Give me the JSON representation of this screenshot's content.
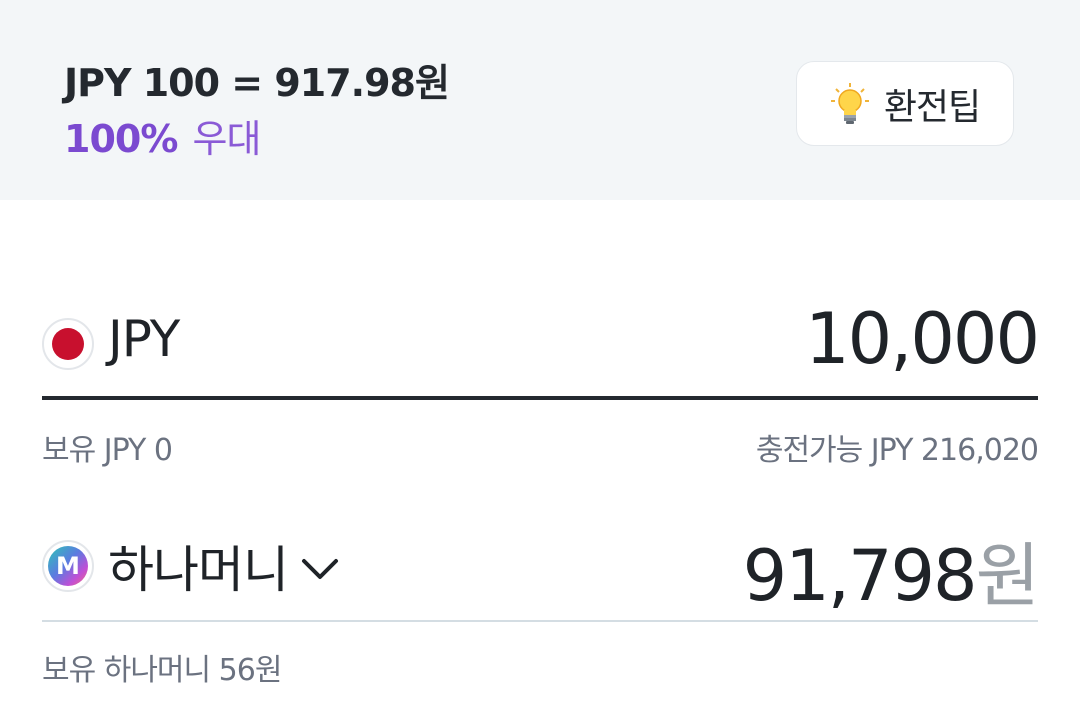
{
  "header": {
    "rate_text": "JPY 100 = 917.98원",
    "discount_pct": "100%",
    "discount_label": "우대",
    "tip_button_label": "환전팁",
    "tip_icon": "lightbulb-icon",
    "background_color": "#f3f6f8",
    "accent_color": "#7b4ad0"
  },
  "from": {
    "currency": "JPY",
    "flag_icon": "japan-flag-icon",
    "amount": "10,000",
    "holding_text": "보유 JPY 0",
    "chargeable_text": "충전가능 JPY 216,020"
  },
  "to": {
    "name": "하나머니",
    "logo_icon": "hana-money-logo-icon",
    "logo_letter": "M",
    "dropdown_icon": "chevron-down-icon",
    "amount": "91,798",
    "unit": "원",
    "holding_text": "보유 하나머니 56원"
  }
}
